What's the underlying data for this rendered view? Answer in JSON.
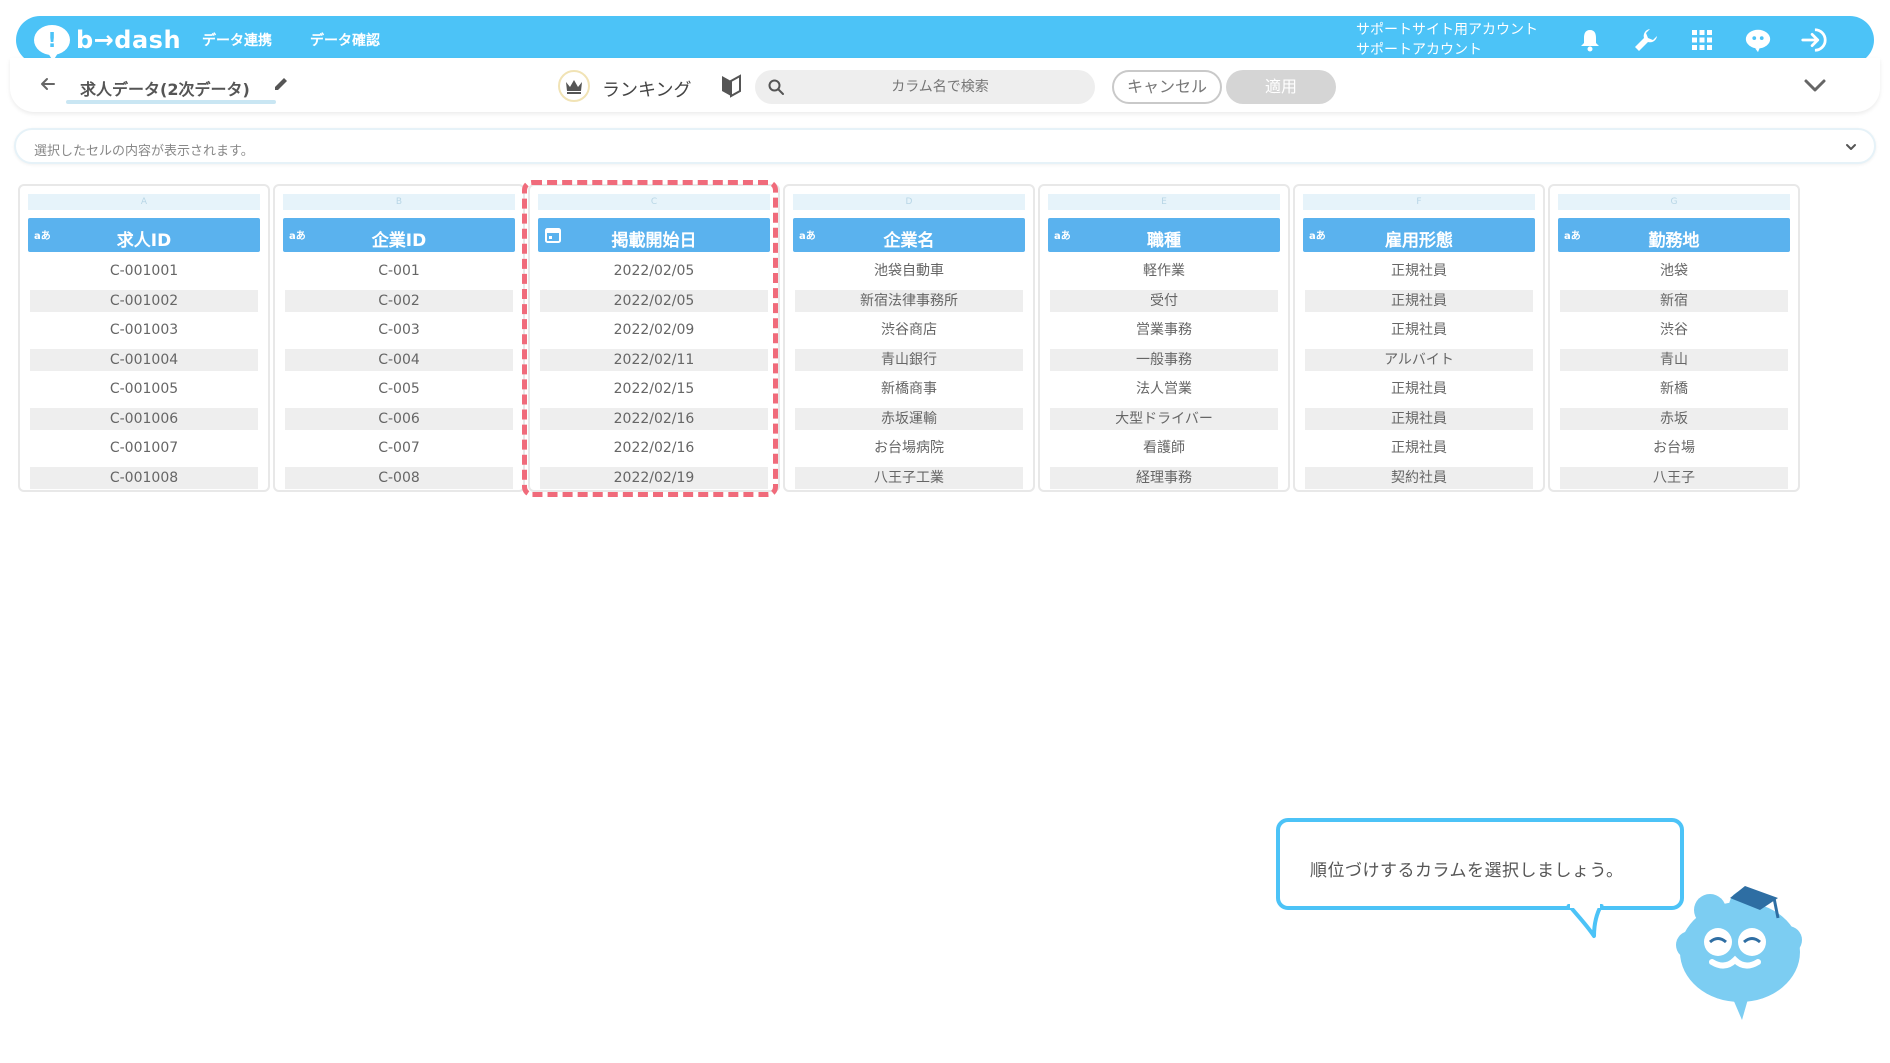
{
  "app": {
    "logo_text": "b→dash",
    "nav": [
      "データ連携",
      "データ確認"
    ],
    "account_line1": "サポートサイト用アカウント",
    "account_line2": "サポートアカウント"
  },
  "toolbar": {
    "dataset_title": "求人データ(2次データ)",
    "mode_label": "ランキング",
    "search_placeholder": "カラム名で検索",
    "cancel_label": "キャンセル",
    "apply_label": "適用"
  },
  "cell_info": {
    "placeholder": "選択したセルの内容が表示されます。"
  },
  "columns": [
    {
      "letter": "A",
      "type": "aあ",
      "name": "求人ID",
      "cells": [
        "C-001001",
        "C-001002",
        "C-001003",
        "C-001004",
        "C-001005",
        "C-001006",
        "C-001007",
        "C-001008"
      ]
    },
    {
      "letter": "B",
      "type": "aあ",
      "name": "企業ID",
      "cells": [
        "C-001",
        "C-002",
        "C-003",
        "C-004",
        "C-005",
        "C-006",
        "C-007",
        "C-008"
      ]
    },
    {
      "letter": "C",
      "type": "calendar",
      "name": "掲載開始日",
      "cells": [
        "2022/02/05",
        "2022/02/05",
        "2022/02/09",
        "2022/02/11",
        "2022/02/15",
        "2022/02/16",
        "2022/02/16",
        "2022/02/19"
      ]
    },
    {
      "letter": "D",
      "type": "aあ",
      "name": "企業名",
      "cells": [
        "池袋自動車",
        "新宿法律事務所",
        "渋谷商店",
        "青山銀行",
        "新橋商事",
        "赤坂運輸",
        "お台場病院",
        "八王子工業"
      ]
    },
    {
      "letter": "E",
      "type": "aあ",
      "name": "職種",
      "cells": [
        "軽作業",
        "受付",
        "営業事務",
        "一般事務",
        "法人営業",
        "大型ドライバー",
        "看護師",
        "経理事務"
      ]
    },
    {
      "letter": "F",
      "type": "aあ",
      "name": "雇用形態",
      "cells": [
        "正規社員",
        "正規社員",
        "正規社員",
        "アルバイト",
        "正規社員",
        "正規社員",
        "正規社員",
        "契約社員"
      ]
    },
    {
      "letter": "G",
      "type": "aあ",
      "name": "勤務地",
      "cells": [
        "池袋",
        "新宿",
        "渋谷",
        "青山",
        "新橋",
        "赤坂",
        "お台場",
        "八王子"
      ]
    }
  ],
  "selected_column": "C",
  "help": {
    "message": "順位づけするカラムを選択しましょう。"
  },
  "colors": {
    "brand": "#4cc3f7",
    "header": "#5ab2ee",
    "highlight": "#f06b7b"
  }
}
